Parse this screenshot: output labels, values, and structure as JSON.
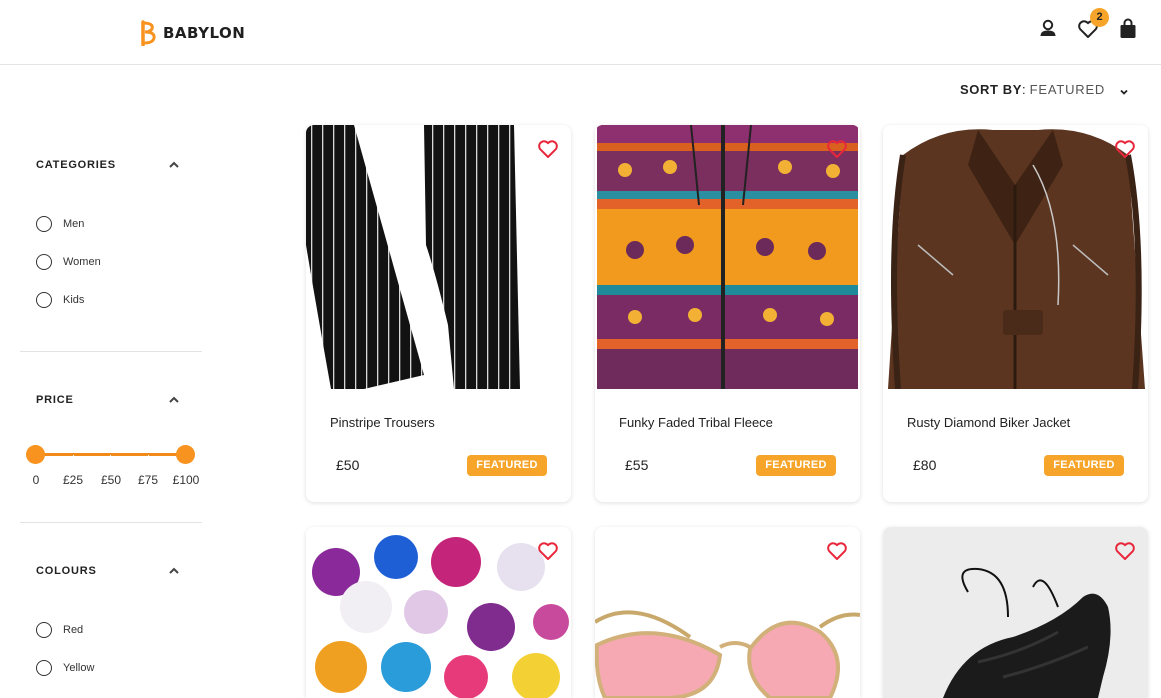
{
  "header": {
    "brand": "BABYLON",
    "wishlist_count": "2",
    "icons": [
      "user-icon",
      "heart-icon",
      "shopping-bag-icon"
    ]
  },
  "sort": {
    "label": "SORT BY",
    "colon": ":",
    "value": "FEATURED"
  },
  "filters": {
    "categories": {
      "title": "CATEGORIES",
      "options": [
        "Men",
        "Women",
        "Kids"
      ]
    },
    "price": {
      "title": "PRICE",
      "ticks": [
        "0",
        "£25",
        "£50",
        "£75",
        "£100"
      ],
      "range_min": 0,
      "range_max": 100
    },
    "colours": {
      "title": "COLOURS",
      "options": [
        "Red",
        "Yellow"
      ]
    }
  },
  "products": [
    {
      "name": "Pinstripe Trousers",
      "price": "£50",
      "badge": "FEATURED"
    },
    {
      "name": "Funky Faded Tribal Fleece",
      "price": "£55",
      "badge": "FEATURED"
    },
    {
      "name": "Rusty Diamond Biker Jacket",
      "price": "£80",
      "badge": "FEATURED"
    },
    {
      "name": "",
      "price": "",
      "badge": ""
    },
    {
      "name": "",
      "price": "",
      "badge": ""
    },
    {
      "name": "",
      "price": "",
      "badge": ""
    }
  ],
  "colors": {
    "accent": "#f7a52a",
    "slider": "#f7931e",
    "heart": "#e8273b"
  }
}
